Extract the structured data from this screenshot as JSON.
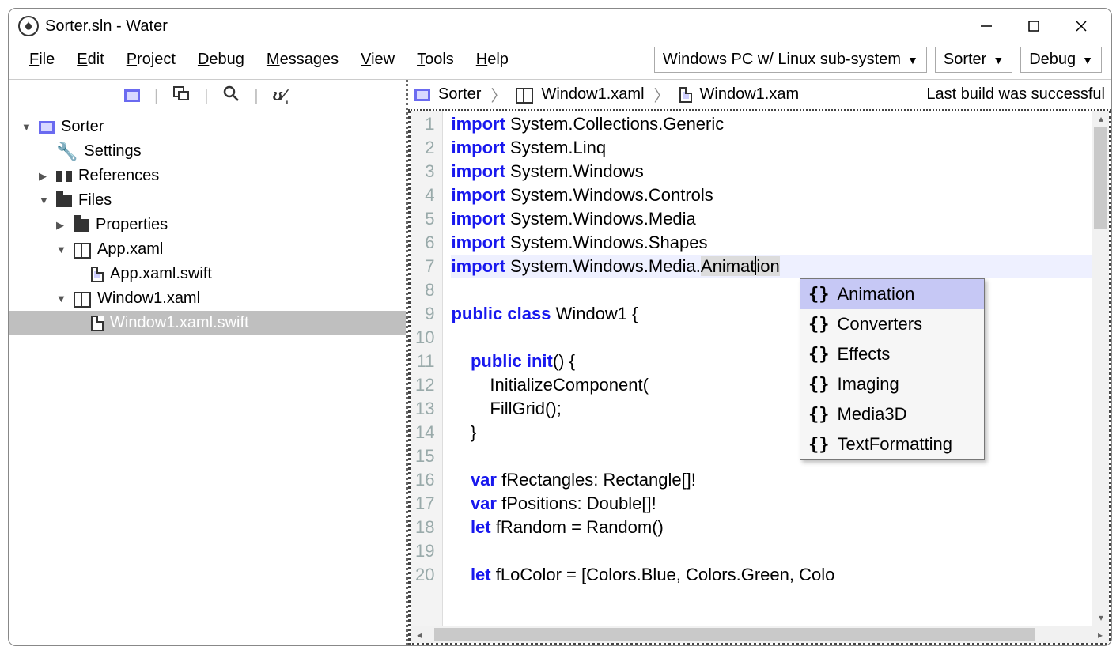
{
  "title": "Sorter.sln - Water",
  "menus": [
    "File",
    "Edit",
    "Project",
    "Debug",
    "Messages",
    "View",
    "Tools",
    "Help"
  ],
  "combos": {
    "target": "Windows PC w/ Linux sub-system",
    "project": "Sorter",
    "config": "Debug"
  },
  "tree": {
    "root": "Sorter",
    "settings": "Settings",
    "references": "References",
    "files": "Files",
    "properties": "Properties",
    "app_xaml": "App.xaml",
    "app_swift": "App.xaml.swift",
    "win_xaml": "Window1.xaml",
    "win_swift": "Window1.xaml.swift"
  },
  "crumb": {
    "a": "Sorter",
    "b": "Window1.xaml",
    "c": "Window1.xam",
    "status": "Last build was successful"
  },
  "editor": {
    "line_count": 20,
    "tokens": [
      [
        [
          "kw",
          "import"
        ],
        [
          "p",
          " System.Collections.Generic"
        ]
      ],
      [
        [
          "kw",
          "import"
        ],
        [
          "p",
          " System.Linq"
        ]
      ],
      [
        [
          "kw",
          "import"
        ],
        [
          "p",
          " System.Windows"
        ]
      ],
      [
        [
          "kw",
          "import"
        ],
        [
          "p",
          " System.Windows.Controls"
        ]
      ],
      [
        [
          "kw",
          "import"
        ],
        [
          "p",
          " System.Windows.Media"
        ]
      ],
      [
        [
          "kw",
          "import"
        ],
        [
          "p",
          " System.Windows.Shapes"
        ]
      ],
      [
        [
          "kw",
          "import"
        ],
        [
          "p",
          " System.Windows.Media."
        ],
        [
          "sel",
          "Animat"
        ],
        [
          "caret",
          ""
        ],
        [
          "sel",
          "ion"
        ]
      ],
      [],
      [
        [
          "kw",
          "public"
        ],
        [
          "p",
          " "
        ],
        [
          "kw",
          "class"
        ],
        [
          "p",
          " Window1 {"
        ]
      ],
      [],
      [
        [
          "p",
          "    "
        ],
        [
          "kw",
          "public"
        ],
        [
          "p",
          " "
        ],
        [
          "kw",
          "init"
        ],
        [
          "p",
          "() {"
        ]
      ],
      [
        [
          "p",
          "        InitializeComponent("
        ]
      ],
      [
        [
          "p",
          "        FillGrid();"
        ]
      ],
      [
        [
          "p",
          "    }"
        ]
      ],
      [],
      [
        [
          "p",
          "    "
        ],
        [
          "kw",
          "var"
        ],
        [
          "p",
          " fRectangles: Rectangle[]!"
        ]
      ],
      [
        [
          "p",
          "    "
        ],
        [
          "kw",
          "var"
        ],
        [
          "p",
          " fPositions: Double[]!"
        ]
      ],
      [
        [
          "p",
          "    "
        ],
        [
          "kw",
          "let"
        ],
        [
          "p",
          " fRandom = Random()"
        ]
      ],
      [],
      [
        [
          "p",
          "    "
        ],
        [
          "kw",
          "let"
        ],
        [
          "p",
          " fLoColor = [Colors.Blue, Colors.Green, Colo"
        ]
      ]
    ],
    "current_line": 7
  },
  "autocomplete": [
    "Animation",
    "Converters",
    "Effects",
    "Imaging",
    "Media3D",
    "TextFormatting"
  ],
  "autocomplete_selected": 0
}
